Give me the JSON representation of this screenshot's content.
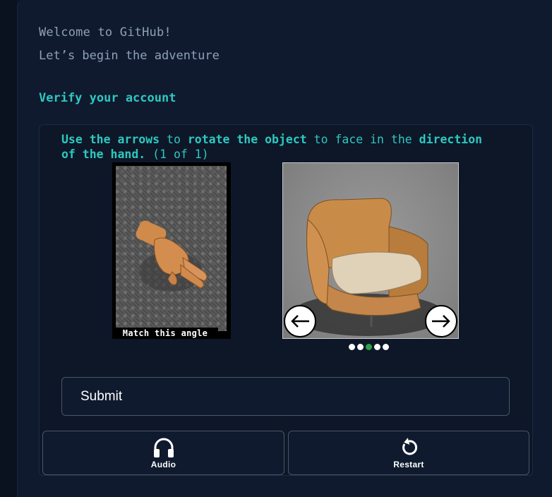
{
  "header": {
    "welcome": "Welcome to GitHub!",
    "subtitle": "Let’s begin the adventure",
    "verify_title": "Verify your account"
  },
  "challenge": {
    "instr_part1": "Use the arrows",
    "instr_part2": " to ",
    "instr_part3": "rotate the object",
    "instr_part4": " to face in the ",
    "instr_part5": "direction of the hand.",
    "instr_part6": " (1 of 1)",
    "hint_label": "Match this angle",
    "left_arrow_icon": "arrow-left-icon",
    "right_arrow_icon": "arrow-right-icon",
    "dots_count": 5,
    "active_dot": 2
  },
  "actions": {
    "submit_label": "Submit",
    "audio_label": "Audio",
    "restart_label": "Restart",
    "audio_icon": "headphones-icon",
    "restart_icon": "restart-icon"
  },
  "colors": {
    "accent": "#2ec8c0",
    "muted_text": "#8ea0b8",
    "background": "#0f1a2e",
    "active_dot": "#2ea043"
  }
}
